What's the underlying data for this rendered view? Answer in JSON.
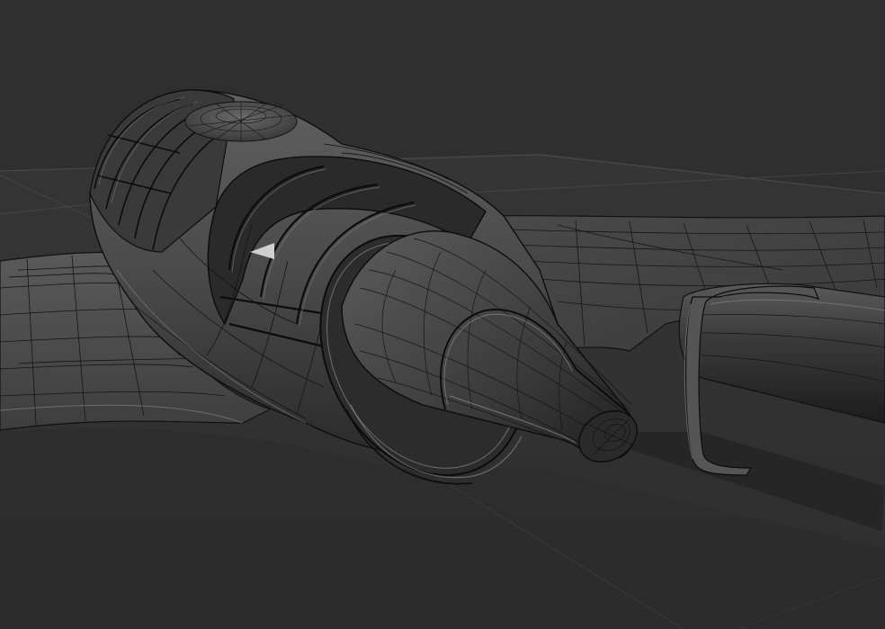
{
  "scene": {
    "background_color": "#303030",
    "floor_color": "#383838",
    "wire_color": "#0a0a0a",
    "highlight_color": "#9a9a9a",
    "subject": "aircraft-wireframe-model"
  }
}
